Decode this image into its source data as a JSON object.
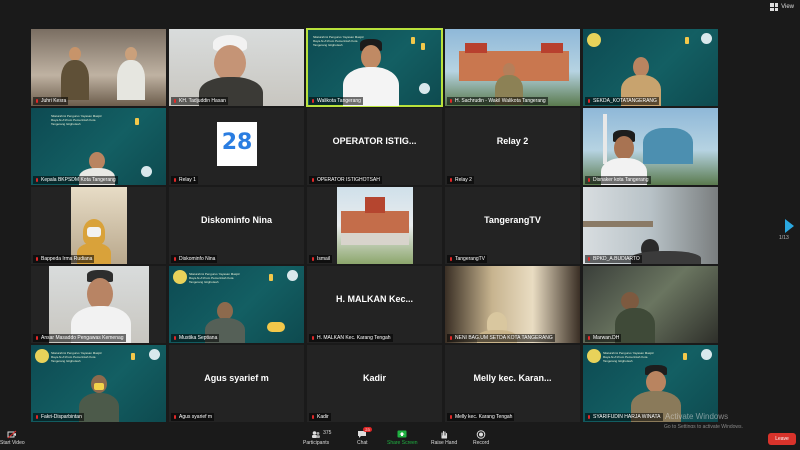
{
  "header": {
    "view_label": "View"
  },
  "tiles": [
    {
      "name": "Juhri Kesra",
      "text": ""
    },
    {
      "name": "KH. Tadjuddin Hasan",
      "text": ""
    },
    {
      "name": "Walikota Tangerang",
      "text": ""
    },
    {
      "name": "H. Sachrudin - Wakil Walikota Tangerang",
      "text": ""
    },
    {
      "name": "SEKDA_KOTATANGERANG",
      "text": ""
    },
    {
      "name": "Kepala BKPSDM Kota Tangerang",
      "text": ""
    },
    {
      "name": "Relay 1",
      "text": ""
    },
    {
      "name": "OPERATOR ISTIGHOTSAH",
      "text": "OPERATOR ISTIG..."
    },
    {
      "name": "Relay 2",
      "text": "Relay 2"
    },
    {
      "name": "Disnaker kota Tangerang",
      "text": ""
    },
    {
      "name": "Bappeda Irma Rudiana",
      "text": ""
    },
    {
      "name": "Diskominfo Nina",
      "text": "Diskominfo Nina"
    },
    {
      "name": "Ismail",
      "text": ""
    },
    {
      "name": "TangerangTV",
      "text": "TangerangTV"
    },
    {
      "name": "BPKD_A.BUDIARTO",
      "text": ""
    },
    {
      "name": "Ansar Masaddo Pengawas Kemenag",
      "text": ""
    },
    {
      "name": "Mustika Septiana",
      "text": ""
    },
    {
      "name": "H. MALKAN Kec. Karang Tengah",
      "text": "H. MALKAN Kec..."
    },
    {
      "name": "NENI BAG.UM SETDA KOTA TANGERANG",
      "text": ""
    },
    {
      "name": "Marwan.DH",
      "text": ""
    },
    {
      "name": "Fakri-Disparbintan",
      "text": ""
    },
    {
      "name": "Agus syarief m",
      "text": "Agus syarief m"
    },
    {
      "name": "Kadir",
      "text": "Kadir"
    },
    {
      "name": "Melly kec. Karang Tengah",
      "text": "Melly kec. Karan..."
    },
    {
      "name": "SYARIFUDIN HARJA WINATA",
      "text": ""
    }
  ],
  "banner": {
    "text": "Silaturahmi Pengurus Yayasan Masjid Raya Al-A'zhom Pemerintah Kota Tangerang Istighotsah"
  },
  "logo_text": "28",
  "pagination": {
    "label": "1/13"
  },
  "toolbar": {
    "start_video": "Start Video",
    "participants_label": "Participants",
    "participants_count": "375",
    "chat_label": "Chat",
    "chat_badge": "23",
    "share_label": "Share Screen",
    "raise_label": "Raise Hand",
    "record_label": "Record",
    "leave_label": "Leave"
  },
  "watermark": {
    "title": "Activate Windows",
    "subtitle": "Go to Settings to activate Windows."
  },
  "colors": {
    "active_border": "#b9e23c",
    "leave": "#d9332b",
    "share": "#1fb141",
    "muted": "#e02828"
  }
}
